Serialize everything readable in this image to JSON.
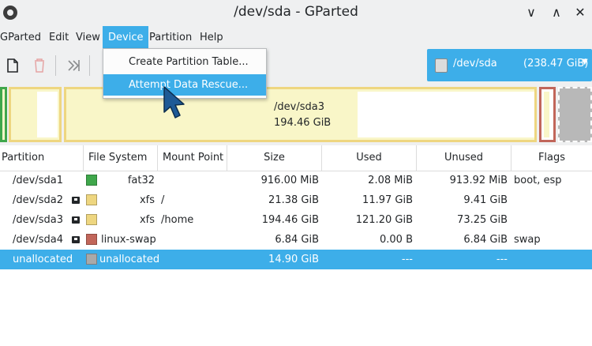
{
  "window": {
    "title": "/dev/sda - GParted",
    "minimize_glyph": "∨",
    "maximize_glyph": "∧",
    "close_glyph": "✕"
  },
  "menubar": {
    "items": [
      "GParted",
      "Edit",
      "View",
      "Device",
      "Partition",
      "Help"
    ],
    "active": "Device"
  },
  "toolbar": {
    "icons": [
      "new-partition-icon",
      "delete-icon",
      "apply-icon"
    ]
  },
  "device_selector": {
    "name": "/dev/sda",
    "size": "(238.47 GiB)"
  },
  "device_menu": {
    "items": [
      "Create Partition Table...",
      "Attempt Data Rescue..."
    ],
    "highlighted": "Attempt Data Rescue..."
  },
  "disk_map": {
    "sda3": {
      "name": "/dev/sda3",
      "size": "194.46 GiB"
    }
  },
  "table": {
    "headers": [
      "Partition",
      "File System",
      "Mount Point",
      "Size",
      "Used",
      "Unused",
      "Flags"
    ],
    "rows": [
      {
        "partition": "/dev/sda1",
        "fs": "fat32",
        "color": "#3fa74b",
        "mount": "",
        "size": "916.00 MiB",
        "used": "2.08 MiB",
        "unused": "913.92 MiB",
        "flags": "boot, esp"
      },
      {
        "partition": "/dev/sda2",
        "fs": "xfs",
        "color": "#eed680",
        "mount": "/",
        "size": "21.38 GiB",
        "used": "11.97 GiB",
        "unused": "9.41 GiB",
        "flags": ""
      },
      {
        "partition": "/dev/sda3",
        "fs": "xfs",
        "color": "#eed680",
        "mount": "/home",
        "size": "194.46 GiB",
        "used": "121.20 GiB",
        "unused": "73.25 GiB",
        "flags": ""
      },
      {
        "partition": "/dev/sda4",
        "fs": "linux-swap",
        "color": "#c1665a",
        "mount": "",
        "size": "6.84 GiB",
        "used": "0.00 B",
        "unused": "6.84 GiB",
        "flags": "swap"
      },
      {
        "partition": "unallocated",
        "fs": "unallocated",
        "color": "#a9a9a9",
        "mount": "",
        "size": "14.90 GiB",
        "used": "---",
        "unused": "---",
        "flags": ""
      }
    ]
  },
  "colors": {
    "accent": "#3daee9",
    "chrome": "#eff0f1"
  }
}
